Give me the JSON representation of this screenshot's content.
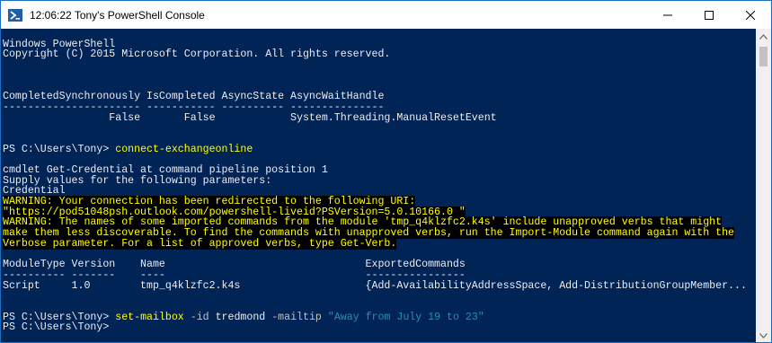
{
  "window": {
    "title": "12:06:22 Tony's PowerShell Console",
    "icon": "powershell-icon",
    "buttons": [
      "minimize-icon",
      "maximize-icon",
      "close-icon"
    ]
  },
  "colors": {
    "console_bg": "#012456",
    "console_fg": "#eeedf0",
    "command": "#ffff00",
    "warning_fg": "#ffff00",
    "warning_bg": "#000000",
    "string": "#2b8db5"
  },
  "console": {
    "header": [
      "Windows PowerShell",
      "Copyright (C) 2015 Microsoft Corporation. All rights reserved."
    ],
    "table1": {
      "header": "CompletedSynchronously IsCompleted AsyncState AsyncWaitHandle",
      "underline": "---------------------- ----------- ---------- ---------------",
      "row": "                 False       False            System.Threading.ManualResetEvent"
    },
    "prompt": "PS C:\\Users\\Tony> ",
    "cmd1": "connect-exchangeonline",
    "credential_lines": [
      "cmdlet Get-Credential at command pipeline position 1",
      "Supply values for the following parameters:",
      "Credential"
    ],
    "warnings": [
      "WARNING: Your connection has been redirected to the following URI:",
      "\"https://pod51048psh.outlook.com/powershell-liveid?PSVersion=5.0.10166.0 \"",
      "WARNING: The names of some imported commands from the module 'tmp_q4klzfc2.k4s' include unapproved verbs that might",
      "make them less discoverable. To find the commands with unapproved verbs, run the Import-Module command again with the",
      "Verbose parameter. For a list of approved verbs, type Get-Verb."
    ],
    "table2": {
      "header": "ModuleType Version    Name                                ExportedCommands",
      "underline": "---------- -------    ----                                ----------------",
      "row": "Script     1.0        tmp_q4klzfc2.k4s                    {Add-AvailabilityAddressSpace, Add-DistributionGroupMember..."
    },
    "cmd2": {
      "cmdlet": "set-mailbox",
      "param1": "-id",
      "arg1": "tredmond",
      "param2": "-mailtip",
      "string": "\"Away from July 19 to 23\""
    },
    "final_prompt": "PS C:\\Users\\Tony>"
  }
}
